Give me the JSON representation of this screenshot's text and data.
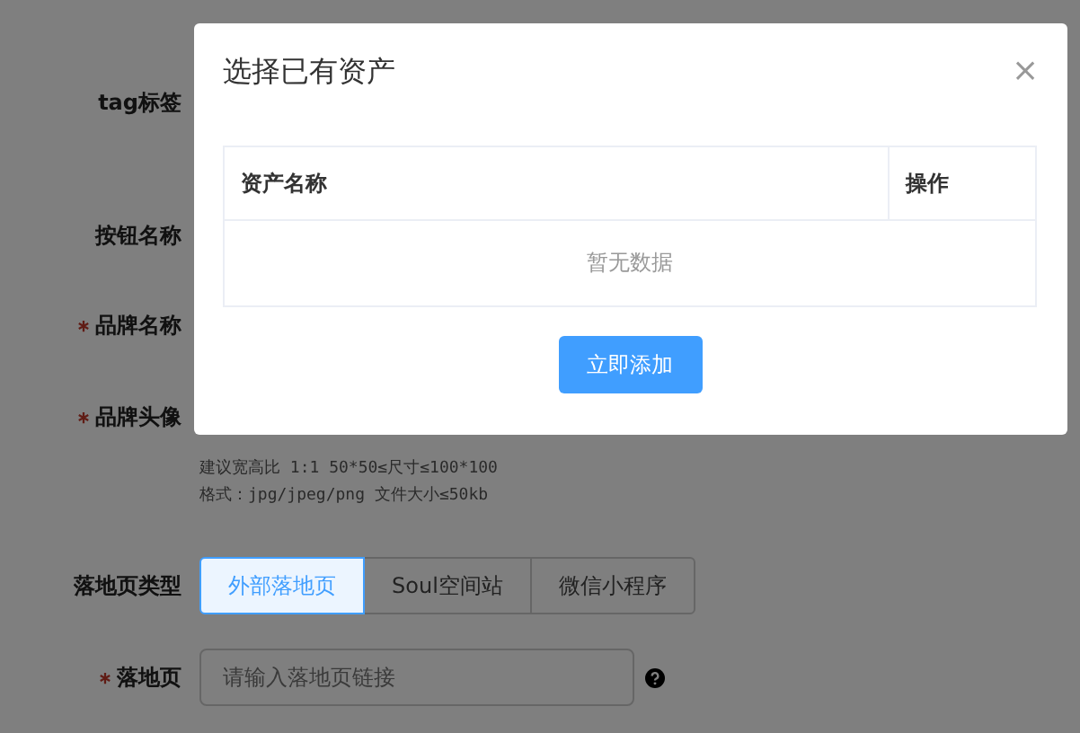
{
  "form": {
    "fields": [
      {
        "kind": "empty",
        "label": "tag标签",
        "required": false
      },
      {
        "kind": "empty",
        "label": "按钮名称",
        "required": false
      },
      {
        "kind": "empty",
        "label": "品牌名称",
        "required": true
      },
      {
        "kind": "empty",
        "label": "品牌头像",
        "required": true
      },
      {
        "kind": "hint",
        "lines": [
          "建议宽高比 1:1 50*50≤尺寸≤100*100",
          "格式：jpg/jpeg/png 文件大小≤50kb"
        ]
      },
      {
        "kind": "segmented",
        "label": "落地页类型",
        "required": false,
        "options": [
          {
            "label": "外部落地页",
            "selected": true
          },
          {
            "label": "Soul空间站",
            "selected": false
          },
          {
            "label": "微信小程序",
            "selected": false
          }
        ]
      },
      {
        "kind": "input",
        "label": "落地页",
        "required": true,
        "placeholder": "请输入落地页链接"
      }
    ]
  },
  "dialog": {
    "title": "选择已有资产",
    "close": "×",
    "table": {
      "columns": [
        "资产名称",
        "操作"
      ],
      "empty_text": "暂无数据"
    },
    "button": "立即添加"
  }
}
